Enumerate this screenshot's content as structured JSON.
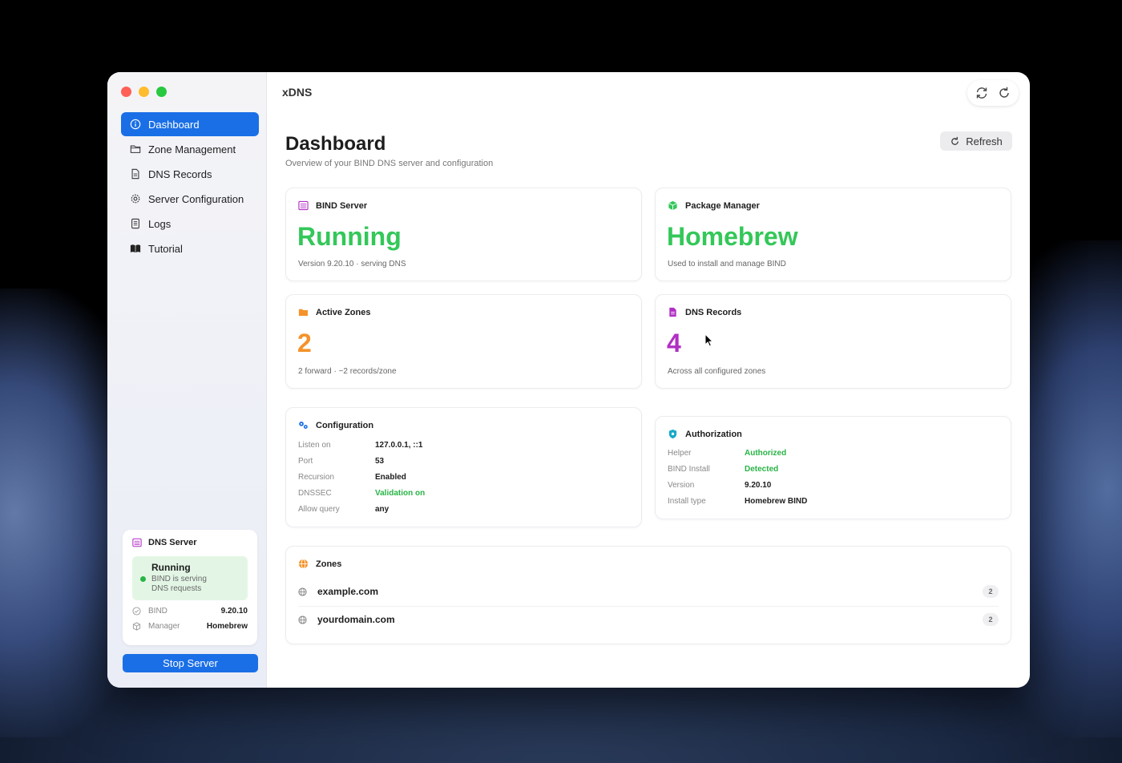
{
  "app": {
    "title": "xDNS"
  },
  "sidebar": {
    "items": [
      {
        "label": "Dashboard",
        "icon": "info-icon",
        "active": true
      },
      {
        "label": "Zone Management",
        "icon": "folder-icon"
      },
      {
        "label": "DNS Records",
        "icon": "document-icon"
      },
      {
        "label": "Server Configuration",
        "icon": "gear-icon"
      },
      {
        "label": "Logs",
        "icon": "log-icon"
      },
      {
        "label": "Tutorial",
        "icon": "book-icon"
      }
    ],
    "status_card": {
      "title": "DNS Server",
      "state": "Running",
      "state_desc": "BIND is serving DNS requests",
      "rows": [
        {
          "label": "BIND",
          "value": "9.20.10"
        },
        {
          "label": "Manager",
          "value": "Homebrew"
        }
      ]
    },
    "stop_button": "Stop Server"
  },
  "header": {
    "title": "Dashboard",
    "subtitle": "Overview of your BIND DNS server and configuration",
    "refresh_label": "Refresh"
  },
  "cards": {
    "bind": {
      "title": "BIND Server",
      "value": "Running",
      "foot": "Version 9.20.10 · serving DNS",
      "color": "#34c759"
    },
    "pkg": {
      "title": "Package Manager",
      "value": "Homebrew",
      "foot": "Used to install and manage BIND",
      "color": "#34c759"
    },
    "zones": {
      "title": "Active Zones",
      "value": "2",
      "foot": "2 forward · ~2 records/zone",
      "color": "#f5922a"
    },
    "records": {
      "title": "DNS Records",
      "value": "4",
      "foot": "Across all configured zones",
      "color": "#b12fc4"
    }
  },
  "configuration": {
    "title": "Configuration",
    "rows": [
      {
        "k": "Listen on",
        "v": "127.0.0.1, ::1"
      },
      {
        "k": "Port",
        "v": "53"
      },
      {
        "k": "Recursion",
        "v": "Enabled"
      },
      {
        "k": "DNSSEC",
        "v": "Validation on"
      },
      {
        "k": "Allow query",
        "v": "any"
      }
    ]
  },
  "authorization": {
    "title": "Authorization",
    "rows": [
      {
        "k": "Helper",
        "v": "Authorized"
      },
      {
        "k": "BIND Install",
        "v": "Detected"
      },
      {
        "k": "Version",
        "v": "9.20.10"
      },
      {
        "k": "Install type",
        "v": "Homebrew BIND"
      }
    ]
  },
  "zones": {
    "title": "Zones",
    "items": [
      {
        "name": "example.com",
        "count": "2"
      },
      {
        "name": "yourdomain.com",
        "count": "2"
      }
    ]
  }
}
